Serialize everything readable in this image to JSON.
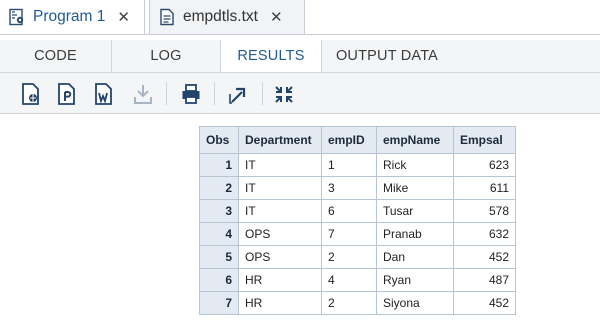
{
  "file_tabs": [
    {
      "label": "Program 1",
      "icon": "program-icon",
      "close": "✕"
    },
    {
      "label": "empdtls.txt",
      "icon": "text-file-icon",
      "close": "✕"
    }
  ],
  "sub_tabs": [
    "CODE",
    "LOG",
    "RESULTS",
    "OUTPUT DATA"
  ],
  "active_sub_tab": "RESULTS",
  "toolbar": [
    "download-html-icon",
    "download-pdf-icon",
    "download-rtf-icon",
    "download-icon",
    "print-icon",
    "open-in-new-window-icon",
    "collapse-icon"
  ],
  "table": {
    "headers": [
      "Obs",
      "Department",
      "empID",
      "empName",
      "Empsal"
    ],
    "rows": [
      [
        "1",
        "IT",
        "1",
        "Rick",
        "623"
      ],
      [
        "2",
        "IT",
        "3",
        "Mike",
        "611"
      ],
      [
        "3",
        "IT",
        "6",
        "Tusar",
        "578"
      ],
      [
        "4",
        "OPS",
        "7",
        "Pranab",
        "632"
      ],
      [
        "5",
        "OPS",
        "2",
        "Dan",
        "452"
      ],
      [
        "6",
        "HR",
        "4",
        "Ryan",
        "487"
      ],
      [
        "7",
        "HR",
        "2",
        "Siyona",
        "452"
      ]
    ]
  },
  "colors": {
    "accent": "#1f5a93",
    "header_bg": "#e4eaf2",
    "border": "#b9c4d3"
  }
}
